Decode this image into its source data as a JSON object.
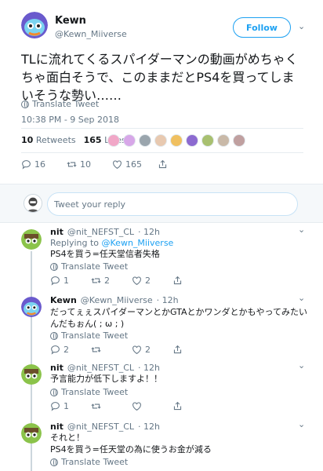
{
  "tweet": {
    "name": "Kewn",
    "handle": "@Kewn_Miiverse",
    "follow_label": "Follow",
    "text": "TLに流れてくるスパイダーマンの動画がめちゃくちゃ面白そうで、このままだとPS4を買ってしまいそうな勢い……",
    "translate": "Translate Tweet",
    "timestamp": "10:38 PM - 9 Sep 2018",
    "retweets_count": "10",
    "retweets_label": "Retweets",
    "likes_count": "165",
    "likes_label": "Likes",
    "actions": {
      "replies": "16",
      "retweets": "10",
      "likes": "165"
    },
    "liker_colors": [
      "#f1a7c7",
      "#d7a7e8",
      "#9aa5ad",
      "#e8c9b0",
      "#f0c060",
      "#8c6ad0",
      "#a8c070",
      "#c9b9a8",
      "#c0a0a0"
    ]
  },
  "reply_bar": {
    "placeholder": "Tweet your reply"
  },
  "replies": [
    {
      "name": "nit",
      "handle": "@nit_NEFST_CL",
      "time": "· 12h",
      "replying_prefix": "Replying to",
      "replying_to": "@Kewn_Miiverse",
      "text": "PS4を買う=任天堂信者失格",
      "translate": "Translate Tweet",
      "replies": "1",
      "retweets": "2",
      "likes": "2"
    },
    {
      "name": "Kewn",
      "handle": "@Kewn_Miiverse",
      "time": "· 12h",
      "text": "だってぇぇスパイダーマンとかGTAとかワンダとかもやってみたいんだもぉん( ; ω ; )",
      "translate": "Translate Tweet",
      "replies": "2",
      "retweets": "",
      "likes": "2"
    },
    {
      "name": "nit",
      "handle": "@nit_NEFST_CL",
      "time": "· 12h",
      "text": "予言能力が低下しますよ！！",
      "translate": "Translate Tweet",
      "replies": "1",
      "retweets": "",
      "likes": ""
    },
    {
      "name": "nit",
      "handle": "@nit_NEFST_CL",
      "time": "· 12h",
      "text": "それと！",
      "text2": "PS4を買う=任天堂の為に使うお金が減る",
      "translate": "Translate Tweet"
    }
  ]
}
